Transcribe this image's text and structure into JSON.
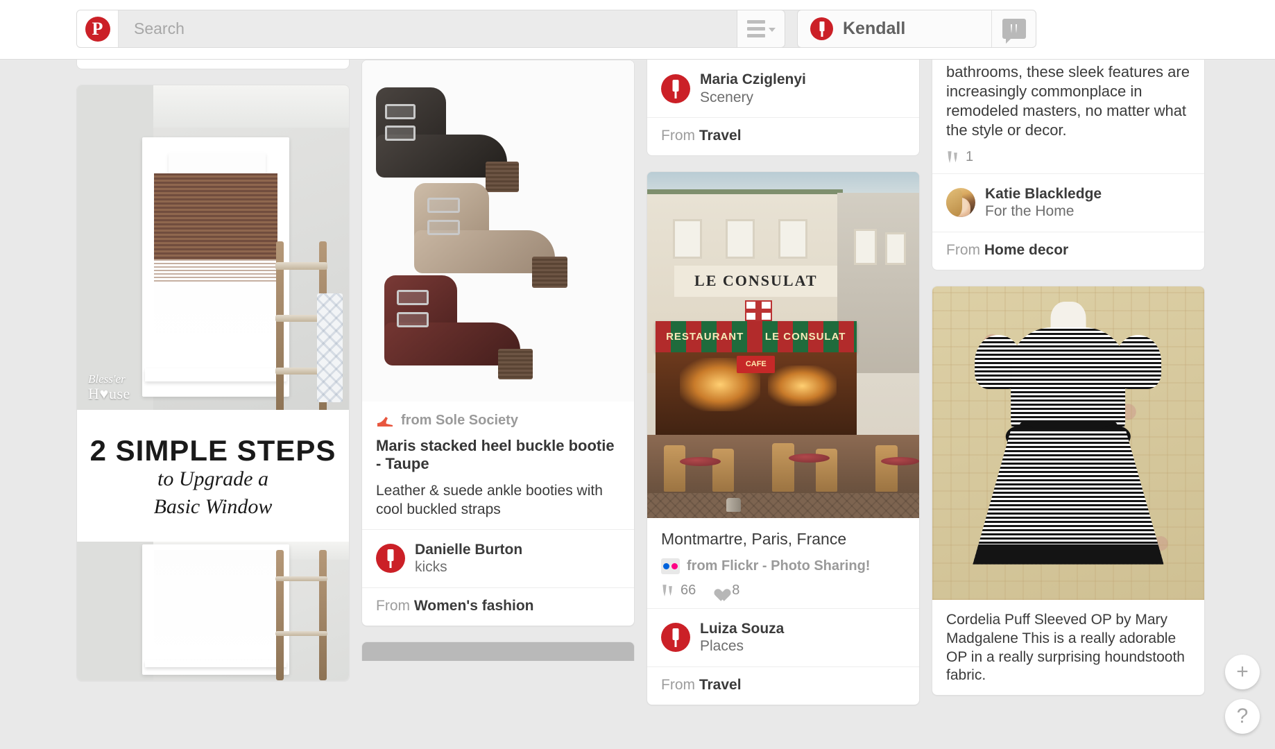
{
  "header": {
    "logo": "pinterest-logo",
    "search": {
      "placeholder": "Search",
      "value": ""
    },
    "menu_icon": "hamburger-menu-icon",
    "user": {
      "name": "Kendall",
      "avatar_icon": "pin-avatar-icon"
    },
    "messages_icon": "messages-icon"
  },
  "columns": [
    {
      "cards": [
        {
          "id": "window-upgrade",
          "image": {
            "alt": "white trimmed window with bamboo blind and rustic ladder",
            "watermark_line1": "Bless'er",
            "watermark_line2": "H♥use"
          },
          "overlay_text": {
            "line1": "2 SIMPLE STEPS",
            "line2": "to Upgrade a",
            "line3": "Basic Window"
          }
        }
      ]
    },
    {
      "cards": [
        {
          "id": "maris-bootie",
          "source_icon": "high-heel-icon",
          "source": "from Sole Society",
          "title": "Maris stacked heel buckle bootie - Taupe",
          "description": "Leather & suede ankle booties with cool buckled straps",
          "user": {
            "name": "Danielle Burton",
            "board": "kicks",
            "avatar_icon": "pin-avatar-icon"
          },
          "from_label": "From",
          "from_category": "Women's fashion"
        }
      ]
    },
    {
      "cards": [
        {
          "id": "scenery-partial",
          "user": {
            "name": "Maria Cziglenyi",
            "board": "Scenery",
            "avatar_icon": "pin-avatar-icon"
          },
          "from_label": "From",
          "from_category": "Travel"
        },
        {
          "id": "montmartre-paris",
          "title": "Montmartre, Paris, France",
          "source_icon": "flickr-icon",
          "source": "from Flickr - Photo Sharing!",
          "stats": {
            "repins_icon": "pin-count-icon",
            "repins": "66",
            "likes_icon": "heart-icon",
            "likes": "8"
          },
          "user": {
            "name": "Luiza Souza",
            "board": "Places",
            "avatar_icon": "pin-avatar-icon"
          },
          "from_label": "From",
          "from_category": "Travel",
          "image_text": {
            "sign": "LE CONSULAT",
            "awning_left": "RESTAURANT",
            "awning_right": "LE CONSULAT",
            "cafe": "CAFE"
          }
        }
      ]
    },
    {
      "cards": [
        {
          "id": "bathroom-partial",
          "description": "bathrooms, these sleek features are increasingly commonplace in remodeled masters, no matter what the style or decor.",
          "stats": {
            "repins_icon": "pin-count-icon",
            "repins": "1"
          },
          "user": {
            "name": "Katie Blackledge",
            "board": "For the Home",
            "avatar_icon": "user-photo-avatar"
          },
          "from_label": "From",
          "from_category": "Home decor"
        },
        {
          "id": "cordelia-dress",
          "description": "Cordelia Puff Sleeved OP by Mary Madgalene This is a really adorable OP in a really surprising houndstooth fabric."
        }
      ]
    }
  ],
  "fab": {
    "add": "+",
    "help": "?"
  },
  "colors": {
    "brand": "#cb2027",
    "page_bg": "#e9e9e9",
    "card_bg": "#ffffff"
  }
}
